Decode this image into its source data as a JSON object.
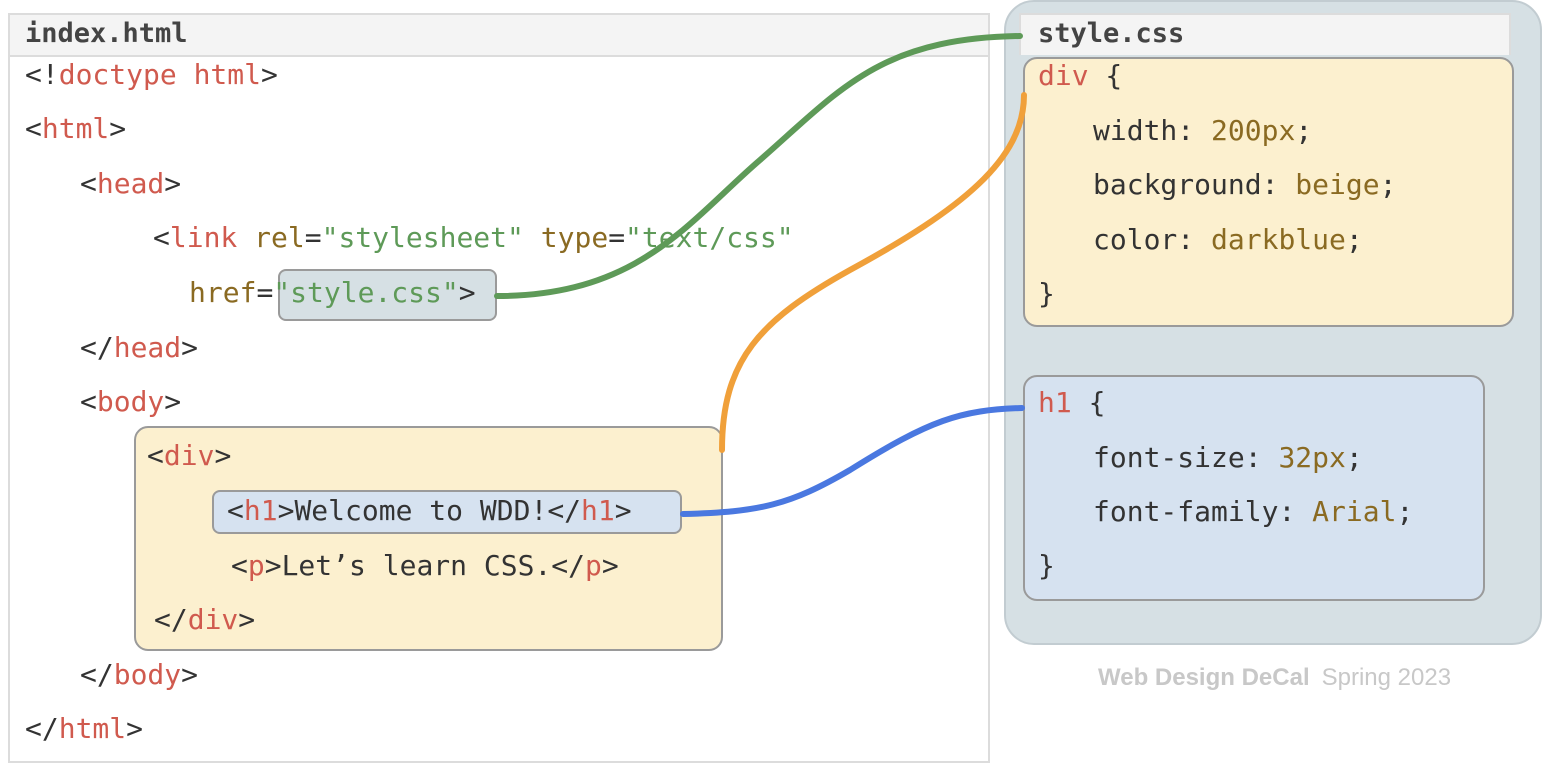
{
  "html_file": {
    "title": "index.html",
    "lines": {
      "doctype": "doctype html",
      "html_open": "html",
      "head_open": "head",
      "link_tag": "link",
      "rel_attr": "rel",
      "rel_value": "\"stylesheet\"",
      "type_attr": "type",
      "type_value": "\"text/css\"",
      "href_attr": "href",
      "href_value": "\"style.css\"",
      "head_close": "head",
      "body_open": "body",
      "div_open": "div",
      "h1_open": "h1",
      "h1_text": "Welcome to WDD!",
      "h1_close": "h1",
      "p_open": "p",
      "p_text": "Let’s learn CSS.",
      "p_close": "p",
      "div_close": "div",
      "body_close": "body",
      "html_close": "html"
    }
  },
  "css_file": {
    "title": "style.css",
    "rules": [
      {
        "selector": "div",
        "declarations": [
          {
            "property": "width",
            "value": "200px"
          },
          {
            "property": "background",
            "value": "beige"
          },
          {
            "property": "color",
            "value": "darkblue"
          }
        ]
      },
      {
        "selector": "h1",
        "declarations": [
          {
            "property": "font-size",
            "value": "32px"
          },
          {
            "property": "font-family",
            "value": "Arial"
          }
        ]
      }
    ]
  },
  "connectors": [
    {
      "from": "href-value",
      "to": "css-file-title",
      "color": "#5e9a58"
    },
    {
      "from": "div-element",
      "to": "div-rule",
      "color": "#f0a03a"
    },
    {
      "from": "h1-element",
      "to": "h1-rule",
      "color": "#4a78e0"
    }
  ],
  "colors": {
    "div_highlight": "#fcf0cf",
    "h1_highlight": "#d6e2f0",
    "href_highlight": "#d6e0e4",
    "tag": "#d05a4e",
    "attr": "#8a6a22",
    "string": "#5e9a58"
  },
  "credit": {
    "course": "Web Design DeCal",
    "term": "Spring 2023"
  }
}
